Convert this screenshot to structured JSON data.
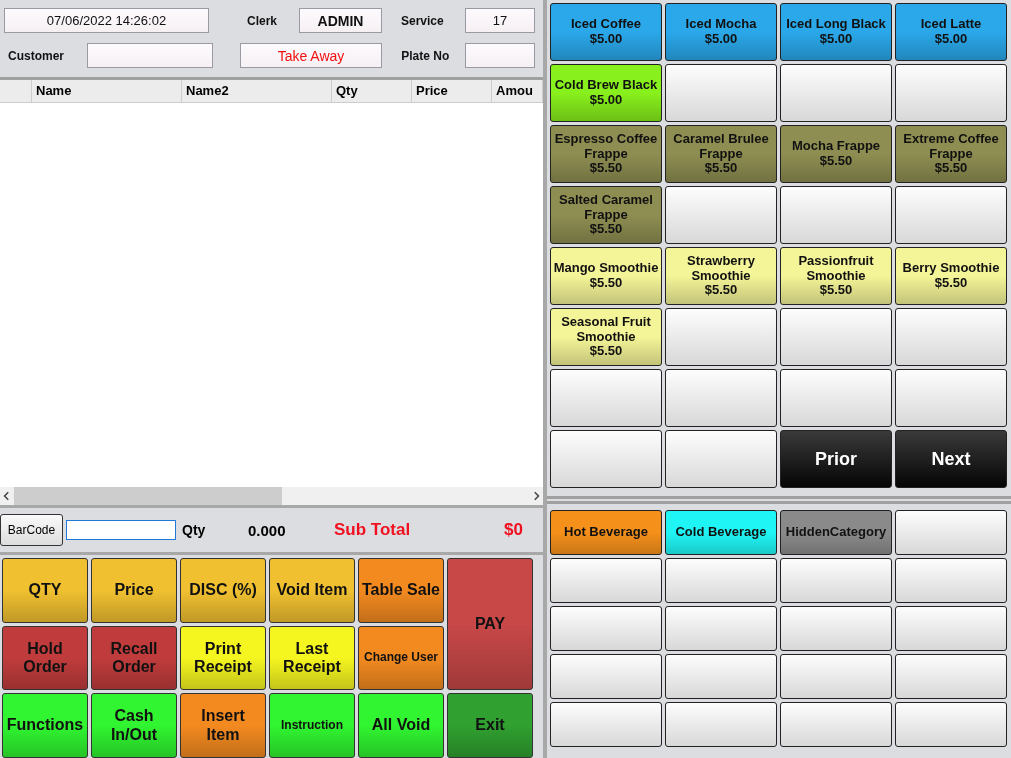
{
  "header": {
    "datetime": "07/06/2022 14:26:02",
    "clerk_label": "Clerk",
    "clerk": "ADMIN",
    "service_label": "Service",
    "service": "17",
    "customer_label": "Customer",
    "order_type": "Take Away",
    "plate_label": "Plate No"
  },
  "table": {
    "columns": [
      "Name",
      "Name2",
      "Qty",
      "Price",
      "Amou"
    ]
  },
  "barcode": {
    "button": "BarCode",
    "qty_label": "Qty",
    "qty": "0.000",
    "subtotal_label": "Sub Total",
    "subtotal": "$0"
  },
  "actions": [
    {
      "label": "QTY",
      "color": "#f0c030",
      "kind": "normal"
    },
    {
      "label": "Price",
      "color": "#f0c030",
      "kind": "normal"
    },
    {
      "label": "DISC (%)",
      "color": "#f0c030",
      "kind": "normal"
    },
    {
      "label": "Void Item",
      "color": "#f0c030",
      "kind": "normal"
    },
    {
      "label": "Table Sale",
      "color": "#f38a20",
      "kind": "normal"
    },
    {
      "label": "PAY",
      "color": "#c84848",
      "kind": "tall"
    },
    {
      "label": "Hold Order",
      "color": "#c03c3c",
      "kind": "normal"
    },
    {
      "label": "Recall Order",
      "color": "#c03c3c",
      "kind": "normal"
    },
    {
      "label": "Print Receipt",
      "color": "#f5f520",
      "kind": "normal"
    },
    {
      "label": "Last Receipt",
      "color": "#f5f520",
      "kind": "normal"
    },
    {
      "label": "Change User",
      "color": "#f38a20",
      "kind": "small"
    },
    {
      "label": "Functions",
      "color": "#30f530",
      "kind": "normal"
    },
    {
      "label": "Cash In/Out",
      "color": "#30f530",
      "kind": "normal"
    },
    {
      "label": "Insert Item",
      "color": "#f38a20",
      "kind": "normal"
    },
    {
      "label": "Instruction",
      "color": "#30f530",
      "kind": "small"
    },
    {
      "label": "All Void",
      "color": "#30f530",
      "kind": "normal"
    },
    {
      "label": "Exit",
      "color": "#30a030",
      "kind": "normal"
    }
  ],
  "items": [
    {
      "kind": "product",
      "name": "Iced Coffee",
      "price": "$5.00",
      "color": "#2aa8ea"
    },
    {
      "kind": "product",
      "name": "Iced Mocha",
      "price": "$5.00",
      "color": "#2aa8ea"
    },
    {
      "kind": "product",
      "name": "Iced Long Black",
      "price": "$5.00",
      "color": "#2aa8ea"
    },
    {
      "kind": "product",
      "name": "Iced Latte",
      "price": "$5.00",
      "color": "#2aa8ea"
    },
    {
      "kind": "product",
      "name": "Cold Brew Black",
      "price": "$5.00",
      "color": "#88f01c"
    },
    {
      "kind": "empty"
    },
    {
      "kind": "empty"
    },
    {
      "kind": "empty"
    },
    {
      "kind": "product",
      "name": "Espresso Coffee Frappe",
      "price": "$5.50",
      "color": "#8e8e52"
    },
    {
      "kind": "product",
      "name": "Caramel Brulee Frappe",
      "price": "$5.50",
      "color": "#8e8e52"
    },
    {
      "kind": "product",
      "name": "Mocha Frappe",
      "price": "$5.50",
      "color": "#8e8e52"
    },
    {
      "kind": "product",
      "name": "Extreme Coffee Frappe",
      "price": "$5.50",
      "color": "#8e8e52"
    },
    {
      "kind": "product",
      "name": "Salted Caramel Frappe",
      "price": "$5.50",
      "color": "#8e8e52"
    },
    {
      "kind": "empty"
    },
    {
      "kind": "empty"
    },
    {
      "kind": "empty"
    },
    {
      "kind": "product",
      "name": "Mango Smoothie",
      "price": "$5.50",
      "color": "#f4f498"
    },
    {
      "kind": "product",
      "name": "Strawberry Smoothie",
      "price": "$5.50",
      "color": "#f4f498"
    },
    {
      "kind": "product",
      "name": "Passionfruit Smoothie",
      "price": "$5.50",
      "color": "#f4f498"
    },
    {
      "kind": "product",
      "name": "Berry Smoothie",
      "price": "$5.50",
      "color": "#f4f498"
    },
    {
      "kind": "product",
      "name": "Seasonal Fruit Smoothie",
      "price": "$5.50",
      "color": "#f4f498"
    },
    {
      "kind": "empty"
    },
    {
      "kind": "empty"
    },
    {
      "kind": "empty"
    },
    {
      "kind": "empty"
    },
    {
      "kind": "empty"
    },
    {
      "kind": "empty"
    },
    {
      "kind": "empty"
    },
    {
      "kind": "empty"
    },
    {
      "kind": "empty"
    },
    {
      "kind": "nav",
      "name": "Prior"
    },
    {
      "kind": "nav",
      "name": "Next"
    }
  ],
  "categories": [
    {
      "kind": "category",
      "name": "Hot Beverage",
      "color": "#f5901a"
    },
    {
      "kind": "category",
      "name": "Cold Beverage",
      "color": "#20f5f5"
    },
    {
      "kind": "category",
      "name": "HiddenCategory",
      "color": "#8a8a8a"
    },
    {
      "kind": "empty"
    },
    {
      "kind": "empty"
    },
    {
      "kind": "empty"
    },
    {
      "kind": "empty"
    },
    {
      "kind": "empty"
    },
    {
      "kind": "empty"
    },
    {
      "kind": "empty"
    },
    {
      "kind": "empty"
    },
    {
      "kind": "empty"
    },
    {
      "kind": "empty"
    },
    {
      "kind": "empty"
    },
    {
      "kind": "empty"
    },
    {
      "kind": "empty"
    },
    {
      "kind": "empty"
    },
    {
      "kind": "empty"
    },
    {
      "kind": "empty"
    },
    {
      "kind": "empty"
    }
  ]
}
